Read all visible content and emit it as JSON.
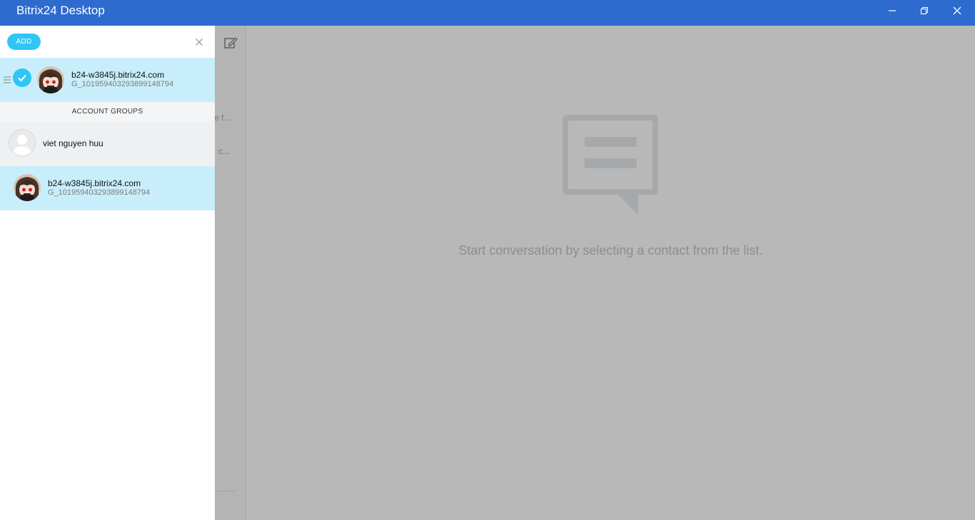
{
  "window": {
    "title": "Bitrix24 Desktop",
    "controls": {
      "minimize": "minimize-icon",
      "maximize": "restore-icon",
      "close": "close-icon"
    },
    "accent": "#2d6bcf"
  },
  "panel": {
    "add_label": "ADD",
    "close_icon": "close-icon",
    "current_account": {
      "domain": "b24-w3845j.bitrix24.com",
      "user_id": "G_101959403293899148794",
      "selected": true
    },
    "groups_header": "ACCOUNT GROUPS",
    "groups": [
      {
        "name": "viet nguyen huu",
        "avatar": "user-placeholder-icon"
      },
      {
        "domain": "b24-w3845j.bitrix24.com",
        "user_id": "G_101959403293899148794",
        "avatar": "anime-avatar"
      }
    ],
    "accent": "#2fc6f6"
  },
  "background": {
    "snippets": [
      "e f...",
      "c..."
    ],
    "empty_message": "Start conversation by selecting a contact from the list."
  }
}
